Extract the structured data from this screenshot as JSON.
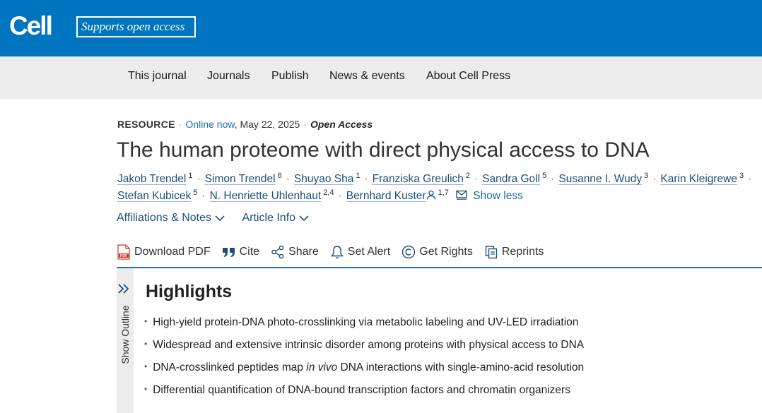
{
  "brand": {
    "logo": "Cell",
    "badge": "Supports open access",
    "bg_color": "#0075bf"
  },
  "nav": {
    "items": [
      "This journal",
      "Journals",
      "Publish",
      "News & events",
      "About Cell Press"
    ]
  },
  "article": {
    "type": "RESOURCE",
    "online": "Online now",
    "date": ", May 22, 2025",
    "access": "Open Access",
    "title": "The human proteome with direct physical access to DNA",
    "authors": [
      {
        "name": "Jakob Trendel",
        "sup": "1"
      },
      {
        "name": "Simon Trendel",
        "sup": "6"
      },
      {
        "name": "Shuyao Sha",
        "sup": "1"
      },
      {
        "name": "Franziska Greulich",
        "sup": "2"
      },
      {
        "name": "Sandra Goll",
        "sup": "5"
      },
      {
        "name": "Susanne I. Wudy",
        "sup": "3"
      },
      {
        "name": "Karin Kleigrewe",
        "sup": "3"
      },
      {
        "name": "Stefan Kubicek",
        "sup": "5"
      },
      {
        "name": "N. Henriette Uhlenhaut",
        "sup": "2,4"
      },
      {
        "name": "Bernhard Kuster",
        "sup": "1,7"
      }
    ],
    "show_less": "Show less",
    "affiliations_label": "Affiliations & Notes",
    "article_info_label": "Article Info"
  },
  "actions": {
    "download_pdf": "Download PDF",
    "cite": "Cite",
    "share": "Share",
    "set_alert": "Set Alert",
    "get_rights": "Get Rights",
    "reprints": "Reprints"
  },
  "outline": {
    "label": "Show Outline"
  },
  "highlights": {
    "title": "Highlights",
    "items": [
      {
        "text": "High-yield protein-DNA photo-crosslinking via metabolic labeling and UV-LED irradiation"
      },
      {
        "text": "Widespread and extensive intrinsic disorder among proteins with physical access to DNA"
      },
      {
        "pre": "DNA-crosslinked peptides map ",
        "em": "in vivo",
        "post": " DNA interactions with single-amino-acid resolution"
      },
      {
        "text": "Differential quantification of DNA-bound transcription factors and chromatin organizers"
      }
    ]
  }
}
